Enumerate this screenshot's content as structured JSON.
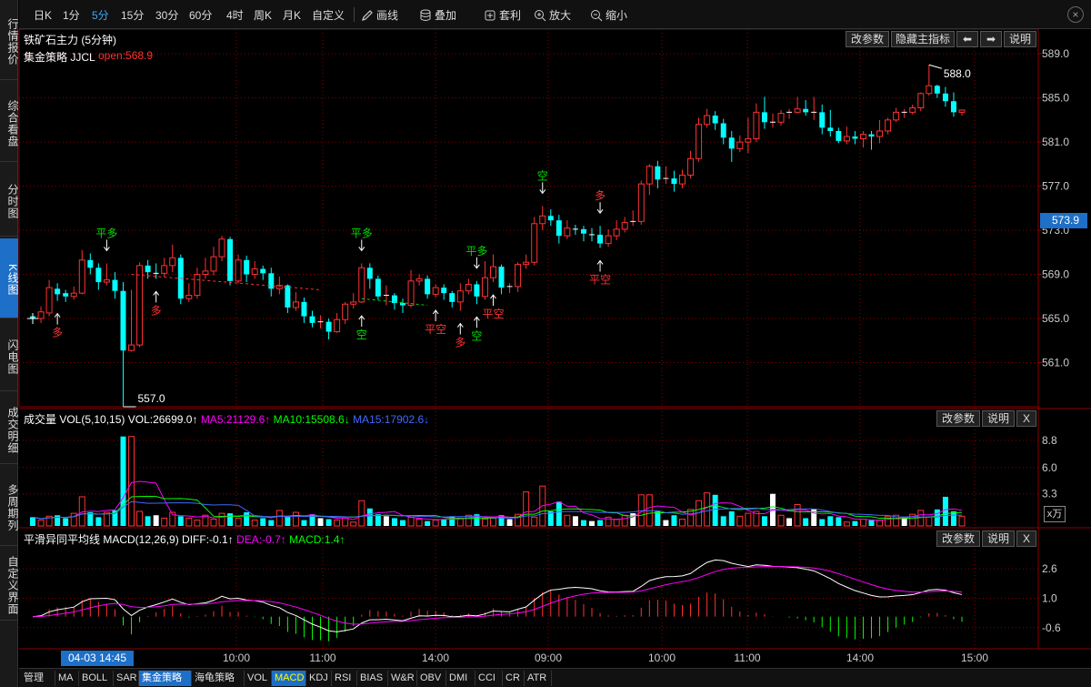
{
  "nav": [
    {
      "label": "行情报价",
      "active": false
    },
    {
      "label": "综合看盘",
      "active": false
    },
    {
      "label": "分时图",
      "active": false
    },
    {
      "label": "K线图",
      "active": true
    },
    {
      "label": "闪电图",
      "active": false
    },
    {
      "label": "成交明细",
      "active": false
    },
    {
      "label": "多周期列",
      "active": false
    },
    {
      "label": "自定义界面",
      "active": false
    }
  ],
  "toolbar": {
    "periods": [
      "日K",
      "1分",
      "5分",
      "15分",
      "30分",
      "60分",
      "4时",
      "周K",
      "月K",
      "自定义"
    ],
    "active_period": "5分",
    "draw": "画线",
    "overlay": "叠加",
    "arbitrage": "套利",
    "zoom_in": "放大",
    "zoom_out": "缩小",
    "close": "×"
  },
  "main_panel": {
    "title": "铁矿石主力 (5分钟)",
    "strategy_name": "集金策略 JJCL",
    "open_label": "open:568.9",
    "buttons": {
      "params": "改参数",
      "hide": "隐藏主指标",
      "explain": "说明"
    }
  },
  "vol_panel": {
    "title": "成交量 VOL(5,10,15)",
    "vol": "VOL:26699.0↑",
    "ma5": "MA5:21129.6↑",
    "ma10": "MA10:15508.6↓",
    "ma15": "MA15:17902.6↓",
    "buttons": {
      "params": "改参数",
      "explain": "说明",
      "close": "X"
    },
    "unit": "x万"
  },
  "macd_panel": {
    "title": "平滑异同平均线 MACD(12,26,9)",
    "diff": "DIFF:-0.1↑",
    "dea": "DEA:-0.7↑",
    "macd": "MACD:1.4↑",
    "buttons": {
      "params": "改参数",
      "explain": "说明",
      "close": "X"
    }
  },
  "current_price": "573.9",
  "cursor_time": "04-03 14:45",
  "bottom_tabs": [
    "管理",
    "MA",
    "BOLL",
    "SAR",
    "集金策略",
    "海龟策略",
    "VOL",
    "MACD",
    "KDJ",
    "RSI",
    "BIAS",
    "W&R",
    "OBV",
    "DMI",
    "CCI",
    "CR",
    "ATR"
  ],
  "colors": {
    "up": "#ff3232",
    "down": "#00ffff",
    "bg": "#000000",
    "grid": "#8b0000",
    "white": "#ffffff",
    "magenta": "#ff00ff",
    "green": "#00ff00",
    "blue": "#4169ff",
    "signal_long": "#ff3232",
    "signal_short": "#00dd00"
  },
  "chart_data": {
    "type": "candlestick",
    "price_axis_ticks": [
      589.0,
      585.0,
      581.0,
      577.0,
      573.0,
      569.0,
      565.0,
      561.0
    ],
    "time_axis_ticks": [
      "10:00",
      "11:00",
      "14:00",
      "09:00",
      "10:00",
      "11:00",
      "14:00",
      "15:00"
    ],
    "ylim": [
      557.0,
      590.0
    ],
    "high_label": "588.0",
    "low_label": "557.0",
    "candles": [
      [
        565.2,
        565.0,
        564.5,
        565.5
      ],
      [
        565.0,
        565.6,
        564.6,
        566.1
      ],
      [
        565.5,
        567.8,
        565.2,
        568.5
      ],
      [
        567.7,
        567.2,
        566.6,
        568.2
      ],
      [
        567.3,
        567.0,
        566.5,
        567.6
      ],
      [
        567.0,
        567.3,
        566.7,
        567.9
      ],
      [
        567.3,
        570.3,
        567.2,
        571.2
      ],
      [
        570.3,
        569.6,
        569.0,
        570.9
      ],
      [
        569.6,
        568.3,
        567.6,
        570.0
      ],
      [
        568.3,
        568.5,
        568.0,
        570.0
      ],
      [
        568.5,
        567.5,
        566.8,
        569.2
      ],
      [
        567.5,
        562.1,
        557.0,
        568.3
      ],
      [
        562.1,
        562.6,
        562.0,
        567.6
      ],
      [
        562.6,
        569.8,
        562.4,
        570.1
      ],
      [
        569.8,
        569.2,
        568.6,
        570.3
      ],
      [
        569.2,
        569.1,
        568.6,
        570.0
      ],
      [
        569.1,
        569.8,
        568.8,
        570.5
      ],
      [
        569.8,
        570.5,
        569.2,
        571.7
      ],
      [
        570.5,
        566.8,
        566.3,
        570.8
      ],
      [
        566.8,
        567.1,
        566.5,
        568.2
      ],
      [
        567.1,
        569.0,
        566.8,
        569.6
      ],
      [
        569.0,
        569.3,
        568.6,
        570.5
      ],
      [
        569.3,
        570.6,
        568.9,
        571.5
      ],
      [
        570.6,
        572.2,
        570.2,
        572.5
      ],
      [
        572.2,
        568.4,
        568.0,
        572.4
      ],
      [
        568.4,
        570.3,
        568.2,
        570.8
      ],
      [
        570.3,
        569.0,
        568.3,
        570.7
      ],
      [
        569.0,
        569.5,
        568.6,
        570.2
      ],
      [
        569.5,
        569.1,
        568.5,
        569.8
      ],
      [
        569.1,
        567.7,
        567.0,
        569.6
      ],
      [
        567.7,
        568.0,
        567.2,
        568.8
      ],
      [
        568.0,
        566.0,
        565.5,
        568.1
      ],
      [
        566.0,
        566.5,
        565.7,
        567.4
      ],
      [
        566.5,
        565.2,
        564.6,
        566.9
      ],
      [
        565.2,
        564.6,
        564.2,
        565.7
      ],
      [
        564.6,
        564.7,
        564.1,
        565.3
      ],
      [
        564.7,
        563.8,
        563.1,
        565.0
      ],
      [
        563.8,
        564.9,
        563.7,
        565.5
      ],
      [
        564.9,
        566.3,
        564.5,
        566.5
      ],
      [
        566.3,
        566.5,
        565.9,
        567.3
      ],
      [
        566.5,
        569.6,
        566.4,
        570.0
      ],
      [
        569.6,
        568.6,
        567.7,
        570.0
      ],
      [
        568.6,
        567.0,
        566.7,
        568.9
      ],
      [
        567.0,
        567.1,
        566.2,
        568.0
      ],
      [
        567.1,
        566.4,
        565.8,
        567.3
      ],
      [
        566.4,
        566.2,
        565.5,
        566.8
      ],
      [
        566.2,
        568.4,
        566.0,
        569.4
      ],
      [
        568.4,
        568.6,
        568.0,
        569.0
      ],
      [
        568.6,
        567.2,
        566.8,
        568.9
      ],
      [
        567.2,
        567.8,
        566.9,
        568.1
      ],
      [
        567.8,
        567.3,
        566.7,
        568.1
      ],
      [
        567.3,
        566.5,
        566.0,
        567.5
      ],
      [
        566.5,
        567.5,
        565.7,
        568.2
      ],
      [
        567.5,
        568.1,
        567.2,
        568.6
      ],
      [
        568.1,
        567.0,
        566.3,
        568.4
      ],
      [
        567.0,
        568.7,
        566.7,
        570.2
      ],
      [
        568.7,
        569.7,
        568.3,
        570.8
      ],
      [
        569.7,
        567.8,
        567.2,
        569.9
      ],
      [
        567.8,
        567.9,
        567.3,
        568.2
      ],
      [
        567.9,
        569.9,
        567.4,
        570.1
      ],
      [
        569.9,
        570.1,
        569.5,
        570.8
      ],
      [
        570.1,
        573.6,
        569.8,
        574.2
      ],
      [
        573.6,
        574.3,
        573.0,
        575.2
      ],
      [
        574.3,
        573.9,
        573.4,
        574.9
      ],
      [
        573.9,
        572.5,
        571.8,
        574.4
      ],
      [
        572.5,
        573.2,
        572.2,
        573.9
      ],
      [
        573.2,
        573.1,
        572.6,
        573.5
      ],
      [
        573.1,
        572.7,
        572.0,
        573.4
      ],
      [
        572.7,
        572.6,
        572.0,
        573.2
      ],
      [
        572.6,
        571.8,
        571.4,
        573.4
      ],
      [
        571.8,
        572.5,
        571.5,
        573.1
      ],
      [
        572.5,
        573.1,
        572.1,
        573.9
      ],
      [
        573.1,
        573.7,
        572.8,
        574.2
      ],
      [
        573.7,
        573.8,
        573.4,
        574.8
      ],
      [
        573.8,
        577.2,
        573.5,
        577.5
      ],
      [
        577.2,
        578.8,
        576.2,
        579.0
      ],
      [
        578.8,
        577.6,
        576.8,
        579.3
      ],
      [
        577.6,
        577.7,
        577.2,
        578.8
      ],
      [
        577.7,
        577.2,
        576.5,
        578.4
      ],
      [
        577.2,
        578.0,
        576.8,
        578.5
      ],
      [
        578.0,
        579.5,
        577.7,
        580.2
      ],
      [
        579.5,
        582.6,
        579.2,
        583.2
      ],
      [
        582.6,
        583.4,
        582.3,
        584.0
      ],
      [
        583.4,
        582.7,
        582.1,
        583.8
      ],
      [
        582.7,
        581.4,
        580.8,
        583.1
      ],
      [
        581.4,
        580.4,
        579.2,
        582.0
      ],
      [
        580.4,
        581.0,
        580.1,
        581.6
      ],
      [
        581.0,
        581.3,
        580.0,
        583.2
      ],
      [
        581.3,
        583.7,
        581.0,
        584.5
      ],
      [
        583.7,
        582.8,
        582.2,
        585.1
      ],
      [
        582.8,
        582.8,
        582.3,
        583.6
      ],
      [
        582.8,
        583.6,
        582.5,
        583.9
      ],
      [
        583.6,
        583.7,
        583.1,
        584.0
      ],
      [
        583.7,
        584.0,
        583.6,
        585.1
      ],
      [
        584.0,
        583.7,
        583.4,
        584.8
      ],
      [
        583.7,
        583.7,
        583.0,
        585.1
      ],
      [
        583.7,
        582.3,
        581.7,
        584.4
      ],
      [
        582.3,
        582.0,
        581.5,
        583.9
      ],
      [
        582.0,
        581.1,
        580.9,
        582.3
      ],
      [
        581.1,
        581.5,
        580.8,
        582.4
      ],
      [
        581.5,
        581.3,
        580.8,
        582.0
      ],
      [
        581.3,
        581.7,
        580.5,
        582.0
      ],
      [
        581.7,
        581.5,
        580.3,
        582.0
      ],
      [
        581.5,
        582.0,
        580.9,
        583.0
      ],
      [
        582.0,
        583.0,
        581.7,
        583.2
      ],
      [
        583.0,
        583.7,
        582.8,
        584.1
      ],
      [
        583.7,
        583.7,
        583.2,
        584.0
      ],
      [
        583.7,
        584.1,
        583.5,
        584.4
      ],
      [
        584.1,
        585.4,
        583.8,
        585.5
      ],
      [
        585.4,
        586.1,
        585.2,
        588.0
      ],
      [
        586.1,
        585.4,
        585.0,
        586.2
      ],
      [
        585.4,
        584.7,
        584.2,
        586.0
      ],
      [
        584.7,
        583.7,
        583.3,
        585.5
      ],
      [
        583.7,
        583.9,
        583.4,
        583.9
      ]
    ],
    "volume_ticks": [
      8.8,
      6.0,
      3.3
    ],
    "volume": [
      0.9,
      0.6,
      1.0,
      1.1,
      0.8,
      1.3,
      3.0,
      1.4,
      0.9,
      1.4,
      1.6,
      9.2,
      9.2,
      1.5,
      1.0,
      1.1,
      0.8,
      1.4,
      1.0,
      0.8,
      0.6,
      1.1,
      0.7,
      1.3,
      1.3,
      0.8,
      1.4,
      0.6,
      0.8,
      0.6,
      1.6,
      1.0,
      1.4,
      0.6,
      1.2,
      0.8,
      0.7,
      0.6,
      0.8,
      0.4,
      2.6,
      1.8,
      1.2,
      1.0,
      0.8,
      0.6,
      0.9,
      0.7,
      0.5,
      0.6,
      0.7,
      1.0,
      0.8,
      1.1,
      1.2,
      0.7,
      0.8,
      1.1,
      0.7,
      1.2,
      3.5,
      0.9,
      4.1,
      1.5,
      2.5,
      1.1,
      1.0,
      0.6,
      0.5,
      0.6,
      0.9,
      0.7,
      1.1,
      1.3,
      3.2,
      3.2,
      1.5,
      0.6,
      1.1,
      0.7,
      1.7,
      2.6,
      3.4,
      3.2,
      1.0,
      1.5,
      1.0,
      1.3,
      1.5,
      1.0,
      3.3,
      1.1,
      0.8,
      2.2,
      0.8,
      1.7,
      0.7,
      1.0,
      0.9,
      0.4,
      0.5,
      0.7,
      0.6,
      0.6,
      1.0,
      1.1,
      0.9,
      1.2,
      1.6,
      0.9,
      1.7,
      3.0,
      1.5,
      1.0
    ],
    "macd_ticks": [
      2.6,
      1.0,
      -0.6
    ],
    "macd_ylim": [
      -1.7,
      3.8
    ],
    "signals": [
      {
        "i": 3,
        "label": "多",
        "side": "long",
        "arrow": "up"
      },
      {
        "i": 9,
        "label": "平多",
        "side": "short",
        "arrow": "down"
      },
      {
        "i": 15,
        "label": "多",
        "side": "long",
        "arrow": "up"
      },
      {
        "i": 40,
        "label": "平多",
        "side": "short",
        "arrow": "down"
      },
      {
        "i": 40,
        "label": "空",
        "side": "short",
        "arrow": "up"
      },
      {
        "i": 49,
        "label": "平空",
        "side": "long",
        "arrow": "up"
      },
      {
        "i": 52,
        "label": "多",
        "side": "long",
        "arrow": "up"
      },
      {
        "i": 54,
        "label": "平多",
        "side": "short",
        "arrow": "down"
      },
      {
        "i": 54,
        "label": "空",
        "side": "short",
        "arrow": "up"
      },
      {
        "i": 56,
        "label": "平空",
        "side": "long",
        "arrow": "up"
      },
      {
        "i": 62,
        "label": "空",
        "side": "short",
        "arrow": "down"
      },
      {
        "i": 69,
        "label": "多",
        "side": "long",
        "arrow": "down"
      },
      {
        "i": 69,
        "label": "平空",
        "side": "long",
        "arrow": "up"
      }
    ]
  }
}
